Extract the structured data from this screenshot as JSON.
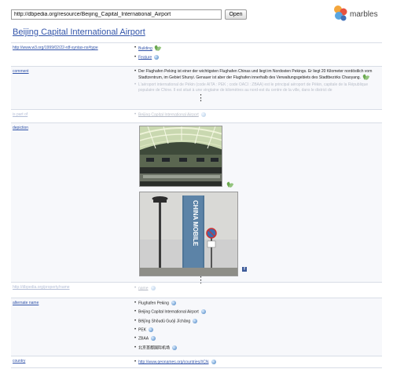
{
  "toolbar": {
    "url_value": "http://dbpedia.org/resource/Beijing_Capital_International_Airport",
    "open_label": "Open"
  },
  "logo": {
    "text": "marbles"
  },
  "page": {
    "title": "Beijing Capital International Airport"
  },
  "rows": {
    "type": {
      "label": "http://www.w3.org/1999/02/22-rdf-syntax-ns#type",
      "values": [
        "Building",
        "Feature"
      ]
    },
    "comment": {
      "label": "comment",
      "de": "Der Flughafen Peking ist einer der wichtigsten Flughafen Chinas und liegt im Nordosten Pekings. Er liegt 20 Kilometer nordöstlich vom Stadtzentrum, im Gebiet Shunyi. Genauer ist aber der Flughafen innerhalb des Verwaltungsgebiets des Stadtbezirks Chaoyang.",
      "fr": "L'aéroport international de Pékin (code AITA : PEK ; code OACI : ZBAA) est le principal aéroport de Pékin, capitale de la République populaire de Chine. Il est situé à une vingtaine de kilomètres au nord-est du centre de la ville, dans le district de"
    },
    "isPartOf": {
      "label": "is part of",
      "value": "Beijing Capital International Airport"
    },
    "depiction": {
      "label": "depiction"
    },
    "name": {
      "label": "http://dbpedia.org/property/name",
      "value": "name"
    },
    "altName": {
      "label": "alternate name",
      "values": [
        "Flughafen Peking",
        "Beijing Capital International Airport",
        "Běijīng Shǒudū Guójì Jīchǎng",
        "PEK",
        "ZBAA",
        "北京首都国际机场"
      ]
    },
    "country": {
      "label": "country",
      "value": "http://www.geonames.org/countries/#CN"
    }
  },
  "photo2": {
    "sign_text": "CHINA MOBILE"
  },
  "icons": {
    "building": "leaf-icon",
    "feature": "globe-icon",
    "more": "more-vertical-icon",
    "facebook": "facebook-icon"
  }
}
